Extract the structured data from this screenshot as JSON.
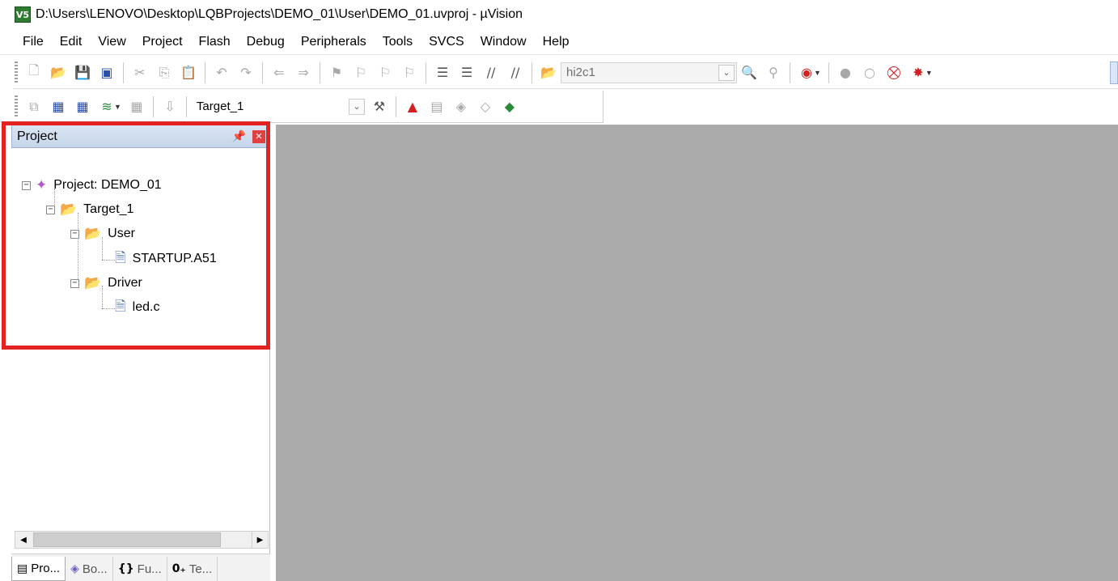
{
  "window": {
    "title": "D:\\Users\\LENOVO\\Desktop\\LQBProjects\\DEMO_01\\User\\DEMO_01.uvproj - µVision",
    "logo_text": "V5"
  },
  "menu": [
    "File",
    "Edit",
    "View",
    "Project",
    "Flash",
    "Debug",
    "Peripherals",
    "Tools",
    "SVCS",
    "Window",
    "Help"
  ],
  "toolbar": {
    "find_value": "hi2c1",
    "target_value": "Target_1"
  },
  "project_panel": {
    "title": "Project",
    "tree": {
      "project": "Project: DEMO_01",
      "target": "Target_1",
      "group_user": "User",
      "file_startup": "STARTUP.A51",
      "group_driver": "Driver",
      "file_led": "led.c"
    },
    "tabs": [
      "Pro...",
      "Bo...",
      "Fu...",
      "Te..."
    ]
  },
  "colors": {
    "highlight": "#e32222",
    "editor_bg": "#ababab",
    "panel_header": "#c5d5ea"
  }
}
